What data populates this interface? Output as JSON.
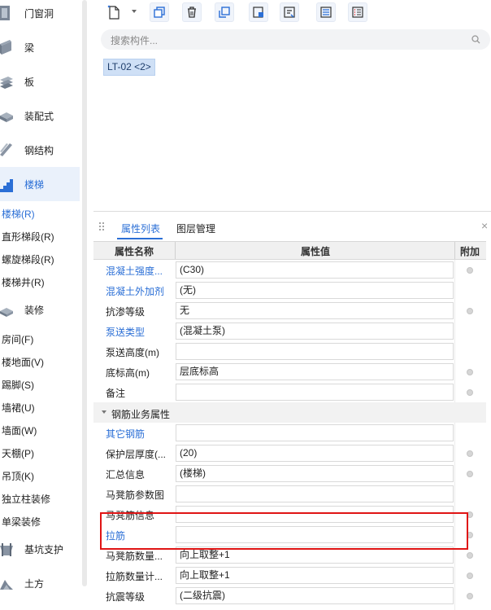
{
  "sidebar": {
    "categories": [
      {
        "label": "门窗洞",
        "icon": "door-window-icon"
      },
      {
        "label": "梁",
        "icon": "beam-icon"
      },
      {
        "label": "板",
        "icon": "slab-icon"
      },
      {
        "label": "装配式",
        "icon": "prefab-icon"
      },
      {
        "label": "钢结构",
        "icon": "steel-structure-icon"
      },
      {
        "label": "楼梯",
        "icon": "stair-icon"
      },
      {
        "label": "装修",
        "icon": "decoration-icon"
      },
      {
        "label": "基坑支护",
        "icon": "pit-support-icon"
      },
      {
        "label": "土方",
        "icon": "earthwork-icon"
      }
    ],
    "stair_items": [
      "楼梯(R)",
      "直形梯段(R)",
      "螺旋梯段(R)",
      "楼梯井(R)"
    ],
    "decoration_items": [
      "房间(F)",
      "楼地面(V)",
      "踢脚(S)",
      "墙裙(U)",
      "墙面(W)",
      "天棚(P)",
      "吊顶(K)",
      "独立柱装修",
      "单梁装修"
    ]
  },
  "toolbar": {
    "buttons": [
      "new-component-icon",
      "copy-icon",
      "delete-icon",
      "duplicate-layer-icon",
      "component-library-icon",
      "extract-icon",
      "list-view-icon",
      "properties-list-icon"
    ]
  },
  "search": {
    "placeholder": "搜索构件..."
  },
  "component": {
    "selected": "LT-02 <2>"
  },
  "panel": {
    "tabs": [
      "属性列表",
      "图层管理"
    ],
    "close": "×",
    "headers": {
      "name": "属性名称",
      "value": "属性值",
      "extra": "附加"
    },
    "rows": [
      {
        "name": "混凝土强度...",
        "value": "(C30)",
        "link": true,
        "radio": true
      },
      {
        "name": "混凝土外加剂",
        "value": "(无)",
        "link": true,
        "radio": false
      },
      {
        "name": "抗渗等级",
        "value": "无",
        "link": false,
        "radio": true
      },
      {
        "name": "泵送类型",
        "value": "(混凝土泵)",
        "link": true,
        "radio": false
      },
      {
        "name": "泵送高度(m)",
        "value": "",
        "link": false,
        "radio": false
      },
      {
        "name": "底标高(m)",
        "value": "层底标高",
        "link": false,
        "radio": true
      },
      {
        "name": "备注",
        "value": "",
        "link": false,
        "radio": true
      }
    ],
    "group": {
      "label": "钢筋业务属性"
    },
    "group_rows": [
      {
        "name": "其它钢筋",
        "value": "",
        "link": true,
        "radio": false
      },
      {
        "name": "保护层厚度(...",
        "value": "(20)",
        "link": false,
        "radio": true
      },
      {
        "name": "汇总信息",
        "value": "(楼梯)",
        "link": false,
        "radio": true
      },
      {
        "name": "马凳筋参数图",
        "value": "",
        "link": false,
        "radio": false
      },
      {
        "name": "马凳筋信息",
        "value": "",
        "link": false,
        "radio": true
      },
      {
        "name": "拉筋",
        "value": "",
        "link": true,
        "radio": true
      },
      {
        "name": "马凳筋数量...",
        "value": "向上取整+1",
        "link": false,
        "radio": true
      },
      {
        "name": "拉筋数量计...",
        "value": "向上取整+1",
        "link": false,
        "radio": true
      },
      {
        "name": "抗震等级",
        "value": "(二级抗震)",
        "link": false,
        "radio": true
      }
    ]
  }
}
